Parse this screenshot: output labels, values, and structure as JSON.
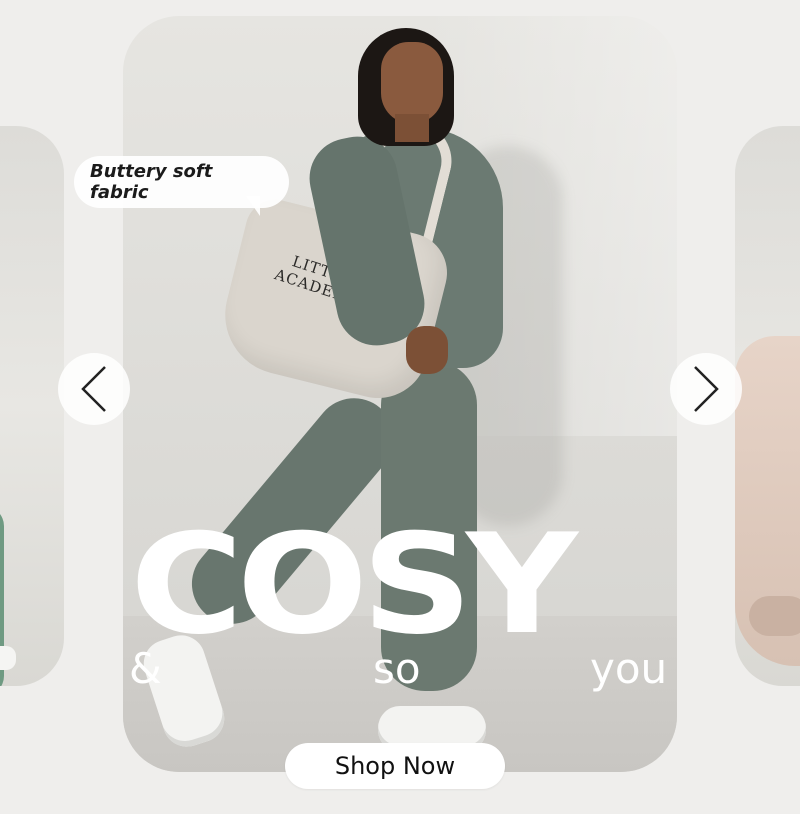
{
  "carousel": {
    "bubble_text": "Buttery soft fabric",
    "headline": "COSY",
    "sub_words": [
      "&",
      "so",
      "you"
    ],
    "cta_label": "Shop Now",
    "bag_print": "LITTLE ACADEMY",
    "prev_icon": "chevron-left-icon",
    "next_icon": "chevron-right-icon"
  },
  "colors": {
    "background": "#efeeec",
    "outfit": "#6b7a72",
    "headline": "#ffffff",
    "cta_bg": "#ffffff",
    "cta_text": "#111111"
  }
}
